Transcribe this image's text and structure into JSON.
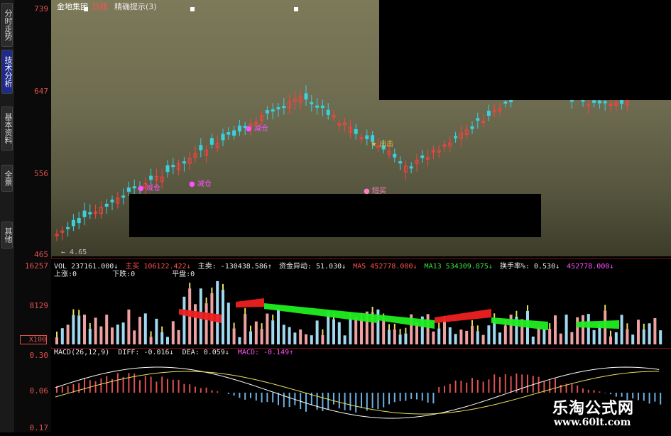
{
  "sidebar": {
    "tabs": [
      {
        "label": "分时走势",
        "active": false
      },
      {
        "label": "技术分析",
        "active": true
      },
      {
        "label": "基本资料",
        "active": false
      },
      {
        "label": "全景",
        "active": false
      },
      {
        "label": "其他",
        "active": false
      }
    ]
  },
  "main": {
    "stock_name": "金地集团",
    "period": "日线",
    "indicator": "精确提示(3)",
    "y_labels": [
      "739",
      "647",
      "556",
      "465"
    ],
    "low_marker": "4.65",
    "signals": {
      "sell1": "减仓",
      "sell2": "减仓",
      "sell3": "减仓",
      "buy_out": "出击",
      "short_buy": "短买"
    }
  },
  "volume": {
    "header": {
      "vol": "VOL 237161.000↓",
      "mainbuy_label": "主买",
      "mainbuy_value": "106122.422↓",
      "mainsell": "主卖: -130438.586↑",
      "capital": "资金异动: 51.030↓",
      "ma5_label": "MA5",
      "ma5_value": "452778.000↓",
      "ma13_label": "MA13",
      "ma13_value": "534309.875↓",
      "turnover": "换手率%: 0.530↓",
      "extra": "452778.000↓"
    },
    "sub": {
      "up": "上涨:0",
      "down": "下跌:0",
      "flat": "平盘:0"
    },
    "y_labels": [
      "16257",
      "8129",
      "X100"
    ]
  },
  "macd": {
    "header": {
      "name": "MACD(26,12,9)",
      "diff": "DIFF: -0.016↓",
      "dea": "DEA: 0.059↓",
      "macd": "MACD: -0.149↑"
    },
    "y_labels": [
      "0.30",
      "0.06",
      "0.17"
    ]
  },
  "watermark": {
    "title": "乐淘公式网",
    "url": "www.60lt.com"
  },
  "colors": {
    "up": "#ff4040",
    "down": "#3ad0e0",
    "axis": "#e05050",
    "fill_red": "#ee2020",
    "fill_green": "#20ee20"
  }
}
